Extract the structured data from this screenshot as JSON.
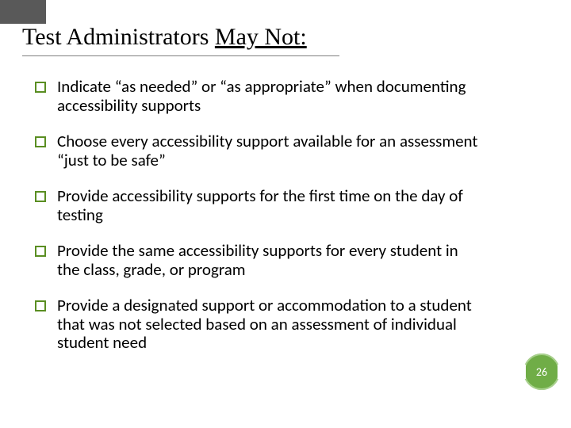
{
  "title": {
    "prefix": "Test Administrators ",
    "emph": "May Not:"
  },
  "bullets": [
    "Indicate “as needed” or “as appropriate” when documenting  accessibility supports",
    "Choose every accessibility support available for an assessment “just to be safe”",
    "Provide accessibility supports for the first time on the day of testing",
    "Provide the same accessibility supports for every student in the class, grade, or program",
    "Provide a designated support or accommodation to a student that was not selected based on an assessment of individual student need"
  ],
  "page_number": "26",
  "colors": {
    "accent": "#70ad47",
    "bullet_border": "#5a8e22",
    "top_block": "#595959"
  }
}
